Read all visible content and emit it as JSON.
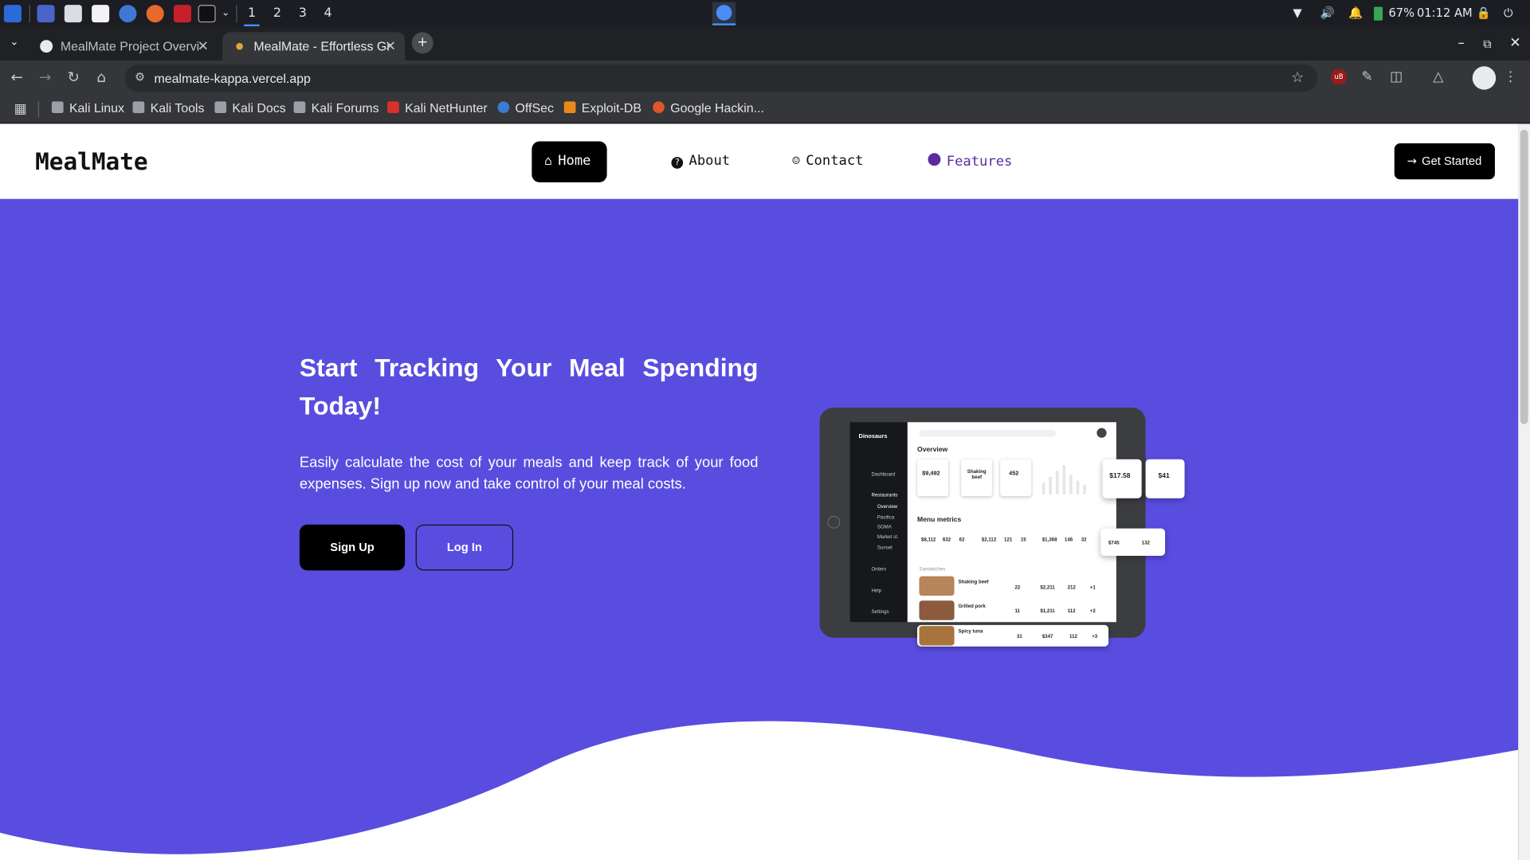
{
  "taskbar": {
    "workspaces": [
      "1",
      "2",
      "3",
      "4"
    ],
    "battery": "67%",
    "clock": "01:12 AM"
  },
  "tabs": [
    {
      "title": "MealMate Project Overvi",
      "active": false
    },
    {
      "title": "MealMate - Effortless Gr",
      "active": true
    }
  ],
  "address_bar": {
    "url": "mealmate-kappa.vercel.app"
  },
  "bookmarks": [
    "Kali Linux",
    "Kali Tools",
    "Kali Docs",
    "Kali Forums",
    "Kali NetHunter",
    "OffSec",
    "Exploit-DB",
    "Google Hackin..."
  ],
  "site": {
    "logo": "MealMate",
    "nav": [
      {
        "label": "Home",
        "icon": "home-icon",
        "active": true
      },
      {
        "label": "About",
        "icon": "question-circle-icon",
        "active": false
      },
      {
        "label": "Contact",
        "icon": "contact-user-icon",
        "active": false
      },
      {
        "label": "Features",
        "icon": "features-icon",
        "active": false
      }
    ],
    "cta": "Get Started",
    "hero": {
      "title": "Start Tracking Your Meal Spending Today!",
      "subtitle": "Easily calculate the cost of your meals and keep track of your food expenses. Sign up now and take control of your meal costs.",
      "signup": "Sign Up",
      "login": "Log In"
    },
    "mockup": {
      "brand": "Dinosaurs",
      "menu": [
        "Dashboard",
        "Restaurants",
        "Overview",
        "Pacifica",
        "SOMA",
        "Market st.",
        "Sunset",
        "Orders",
        "Help",
        "Settings"
      ],
      "overview": "Overview",
      "kpis": [
        "$9,492",
        "Shaking beef",
        "452"
      ],
      "float_kpis": [
        "$17.58",
        "$41"
      ],
      "menu_metrics": "Menu metrics",
      "metrics": [
        "$8,112",
        "632",
        "62",
        "$2,112",
        "121",
        "15",
        "$1,368",
        "146",
        "32"
      ],
      "float_metrics": [
        "$745",
        "132"
      ],
      "section": "Sandwiches",
      "rows": [
        {
          "name": "Shaking beef",
          "v1": "22",
          "v2": "$2,211",
          "v3": "212",
          "v4": "+1"
        },
        {
          "name": "Grilled pork",
          "v1": "11",
          "v2": "$1,211",
          "v3": "112",
          "v4": "+2"
        },
        {
          "name": "Spicy tuna",
          "v1": "31",
          "v2": "$347",
          "v3": "112",
          "v4": "+3"
        }
      ]
    }
  },
  "colors": {
    "hero_bg": "#594de0",
    "features_link": "#5a2ca0"
  }
}
